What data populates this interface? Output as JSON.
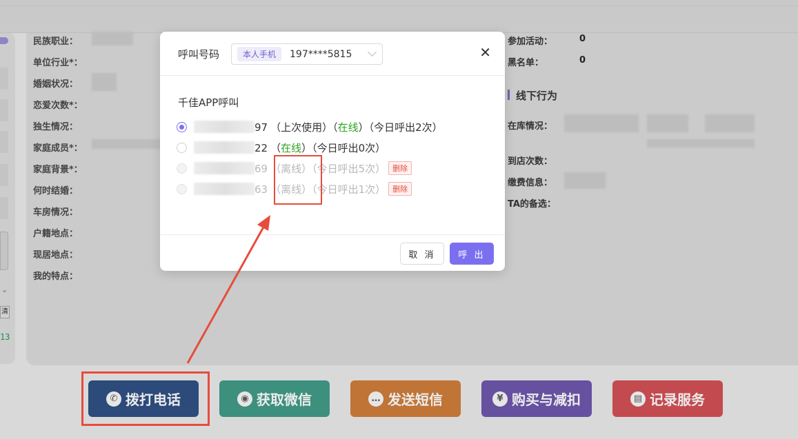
{
  "background": {
    "left_fields": [
      "民族职业：",
      "单位行业*：",
      "婚姻状况：",
      "恋爱次数*：",
      "独生情况：",
      "家庭成员*：",
      "家庭背景*：",
      "何时结婚：",
      "车房情况：",
      "户籍地点：",
      "现居地点：",
      "我的特点："
    ],
    "right_fields": {
      "activity_label": "参加活动：",
      "activity_value": "0",
      "blacklist_label": "黑名单：",
      "blacklist_value": "0",
      "section_title": "线下行为",
      "stock_label": "在库情况：",
      "visits_label": "到店次数：",
      "payment_label": "缴费信息：",
      "candidates_label": "TA的备选："
    },
    "left_strip": {
      "button_text": "清",
      "number_text": "13"
    }
  },
  "actions": {
    "call": "拨打电话",
    "wechat": "获取微信",
    "sms": "发送短信",
    "buy": "购买与减扣",
    "record": "记录服务"
  },
  "dialog": {
    "title_label": "呼叫号码",
    "select_tag": "本人手机",
    "select_value": "197****5815",
    "section": "千佳APP呼叫",
    "rows": [
      {
        "suffix": "97",
        "p1": "（上次使用）（",
        "status": "在线",
        "p2": "）（今日呼出2次）",
        "selected": true,
        "online": true
      },
      {
        "suffix": "22",
        "p1": "（",
        "status": "在线",
        "p2": "）（今日呼出0次）",
        "selected": false,
        "online": true
      },
      {
        "suffix": "69",
        "p1": "（",
        "status": "离线",
        "p2": "）（今日呼出5次）",
        "delete": "删除",
        "selected": false,
        "online": false
      },
      {
        "suffix": "63",
        "p1": "（",
        "status": "离线",
        "p2": "）（今日呼出1次）",
        "delete": "删除",
        "selected": false,
        "online": false
      }
    ],
    "cancel": "取 消",
    "confirm": "呼 出"
  },
  "colors": {
    "accent": "#7b6ff0",
    "online": "#2ea121",
    "annotation": "#e74c3c"
  }
}
